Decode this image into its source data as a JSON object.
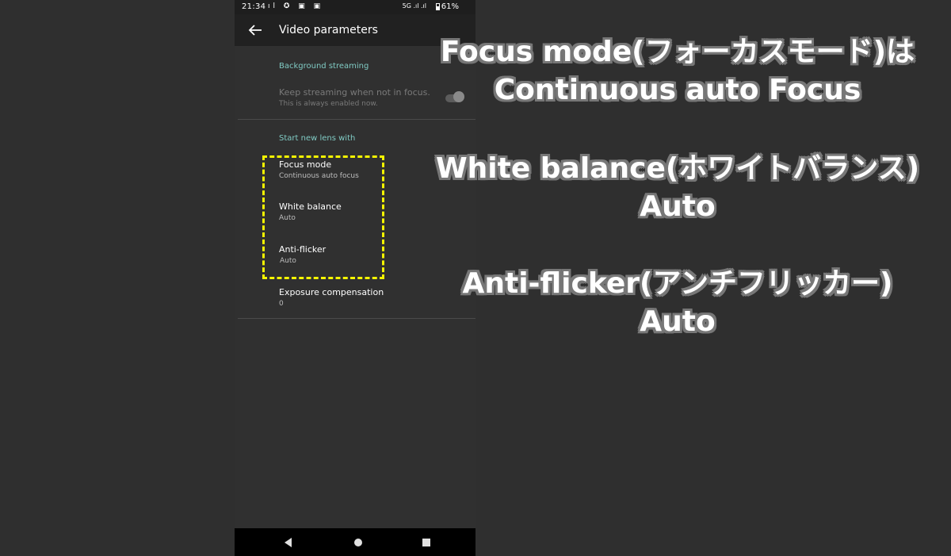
{
  "status_bar": {
    "time": "21:34",
    "left_icons": "ıl ✪ ▣ ▣",
    "network": "5G .ıl .ıl",
    "battery": "61%"
  },
  "app_bar": {
    "back_icon": "arrow-left-icon",
    "title": "Video parameters"
  },
  "sections": {
    "background": {
      "header": "Background streaming",
      "keep_title": "Keep streaming when not in focus.",
      "keep_subtitle": "This is always enabled now.",
      "keep_enabled": true
    },
    "lens": {
      "header": "Start new lens with",
      "focus_title": "Focus mode",
      "focus_value": "Continuous auto focus",
      "wb_title": "White balance",
      "wb_value": "Auto",
      "af_title": "Anti-flicker",
      "af_value": "Auto",
      "exposure_title": "Exposure compensation",
      "exposure_value": "0"
    }
  },
  "overlay": {
    "line1": "Focus mode(フォーカスモード)は",
    "line2": "Continuous auto Focus",
    "line3": "White balance(ホワイトバランス)",
    "line4": "Auto",
    "line5": "Anti-flicker(アンチフリッカー)",
    "line6": "Auto"
  },
  "colors": {
    "accent": "#80cbc4",
    "highlight": "#f5f500",
    "background": "#2f2f2f"
  }
}
